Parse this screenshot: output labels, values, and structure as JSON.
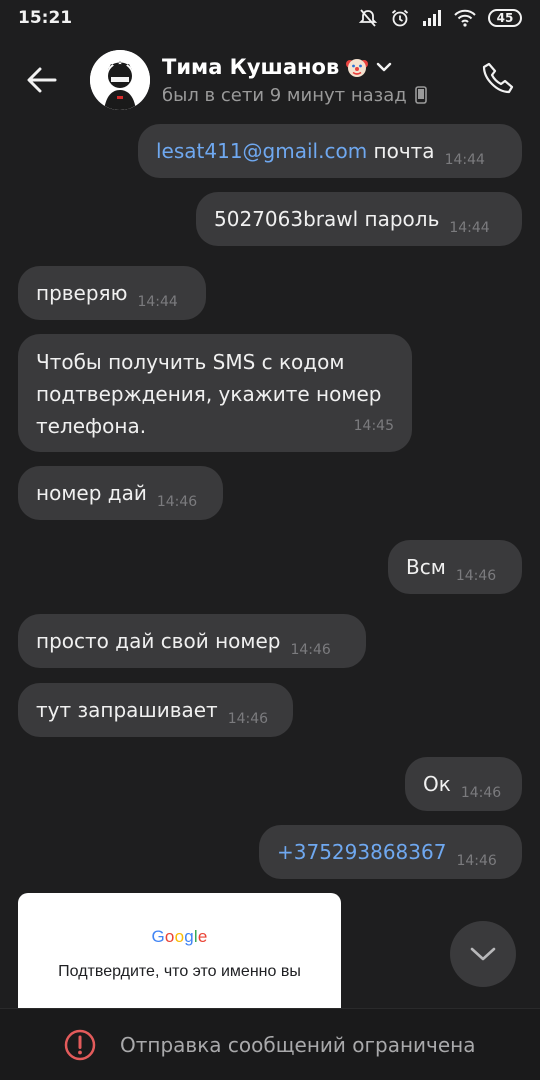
{
  "status_bar": {
    "time": "15:21",
    "battery": "45",
    "icons": [
      "mute-icon",
      "alarm-icon",
      "signal-icon",
      "wifi-icon",
      "battery-icon"
    ]
  },
  "header": {
    "contact_name": "Тима Кушанов",
    "contact_status": "был в сети 9 минут назад",
    "icons": [
      "back-arrow-icon",
      "clown-emoji-icon",
      "chevron-down-icon",
      "phone-device-icon",
      "phone-call-icon"
    ]
  },
  "messages": [
    {
      "direction": "out",
      "link": "lesat411@gmail.com",
      "text": " почта",
      "time": "14:44"
    },
    {
      "direction": "out",
      "text": "5027063brawl пароль",
      "time": "14:44"
    },
    {
      "direction": "in",
      "text": "прверяю",
      "time": "14:44"
    },
    {
      "direction": "in",
      "lines": [
        "Чтобы получить SMS с кодом",
        "подтверждения, укажите номер",
        "телефона."
      ],
      "time": "14:45"
    },
    {
      "direction": "in",
      "text": "номер дай",
      "time": "14:46"
    },
    {
      "direction": "out",
      "text": "Всм",
      "time": "14:46"
    },
    {
      "direction": "in",
      "text": "просто дай свой номер",
      "time": "14:46"
    },
    {
      "direction": "in",
      "text": "тут запрашивает",
      "time": "14:46"
    },
    {
      "direction": "out",
      "text": "Ок",
      "time": "14:46"
    },
    {
      "direction": "out",
      "link": "+375293868367",
      "time": "14:46"
    }
  ],
  "google_card": {
    "logo": "Google",
    "text": "Подтвердите, что это именно вы",
    "logo_colors": [
      "#4285F4",
      "#EA4335",
      "#FBBC05",
      "#4285F4",
      "#34A853",
      "#EA4335"
    ]
  },
  "bottom_bar": {
    "text": "Отправка сообщений ограничена",
    "warning_color": "#e35b5b"
  },
  "colors": {
    "background": "#1e1e1f",
    "bubble": "#3a3a3c",
    "link": "#6fa8f0"
  }
}
